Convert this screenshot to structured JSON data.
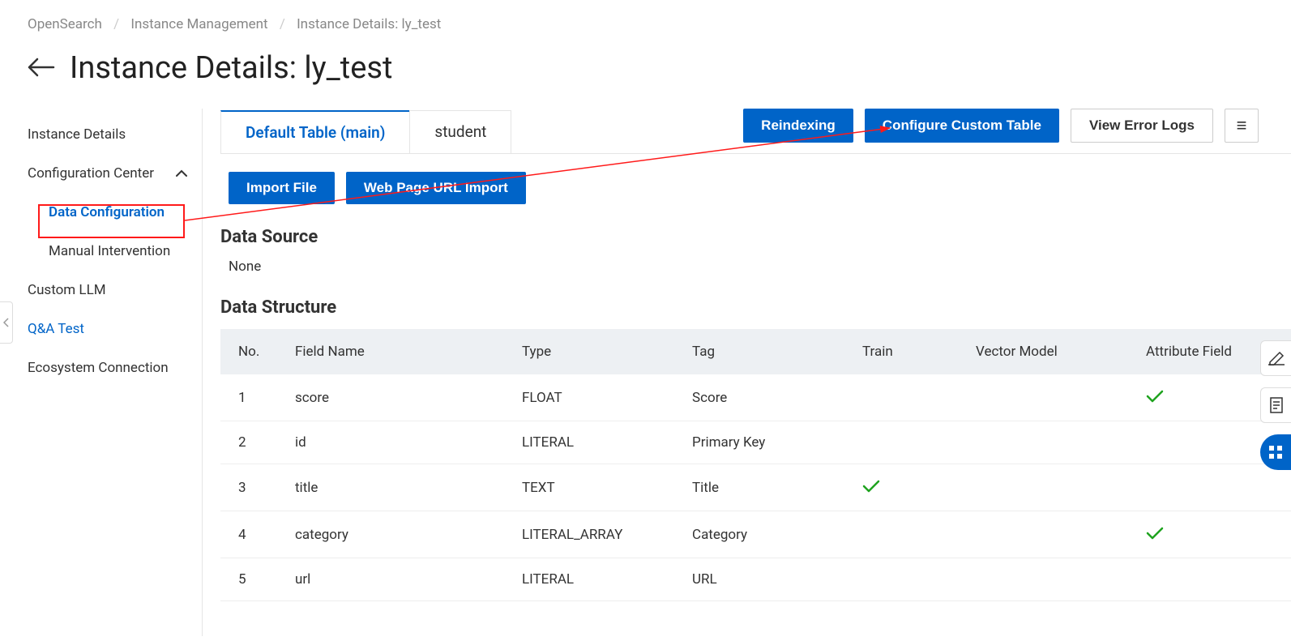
{
  "breadcrumb": {
    "items": [
      "OpenSearch",
      "Instance Management",
      "Instance Details: ly_test"
    ]
  },
  "page_title": "Instance Details: ly_test",
  "sidebar": {
    "items": [
      {
        "label": "Instance Details",
        "type": "item"
      },
      {
        "label": "Configuration Center",
        "type": "expandable",
        "expanded": true
      },
      {
        "label": "Data Configuration",
        "type": "child",
        "active": true
      },
      {
        "label": "Manual Intervention",
        "type": "child"
      },
      {
        "label": "Custom LLM",
        "type": "item"
      },
      {
        "label": "Q&A Test",
        "type": "item",
        "link": true
      },
      {
        "label": "Ecosystem Connection",
        "type": "item"
      }
    ]
  },
  "top_actions": {
    "reindexing": "Reindexing",
    "configure_custom_table": "Configure Custom Table",
    "view_error_logs": "View Error Logs",
    "menu": "≡"
  },
  "tabs": [
    {
      "label": "Default Table (main)",
      "active": true
    },
    {
      "label": "student",
      "active": false
    }
  ],
  "sub_actions": {
    "import_file": "Import File",
    "web_page_url_import": "Web Page URL Import"
  },
  "data_source": {
    "heading": "Data Source",
    "value": "None"
  },
  "data_structure": {
    "heading": "Data Structure",
    "columns": [
      "No.",
      "Field Name",
      "Type",
      "Tag",
      "Train",
      "Vector Model",
      "Attribute Field"
    ],
    "rows": [
      {
        "no": "1",
        "field": "score",
        "type": "FLOAT",
        "tag": "Score",
        "train": false,
        "vector": "",
        "attr": true
      },
      {
        "no": "2",
        "field": "id",
        "type": "LITERAL",
        "tag": "Primary Key",
        "train": false,
        "vector": "",
        "attr": false
      },
      {
        "no": "3",
        "field": "title",
        "type": "TEXT",
        "tag": "Title",
        "train": true,
        "vector": "",
        "attr": false
      },
      {
        "no": "4",
        "field": "category",
        "type": "LITERAL_ARRAY",
        "tag": "Category",
        "train": false,
        "vector": "",
        "attr": true
      },
      {
        "no": "5",
        "field": "url",
        "type": "LITERAL",
        "tag": "URL",
        "train": false,
        "vector": "",
        "attr": false
      }
    ]
  }
}
